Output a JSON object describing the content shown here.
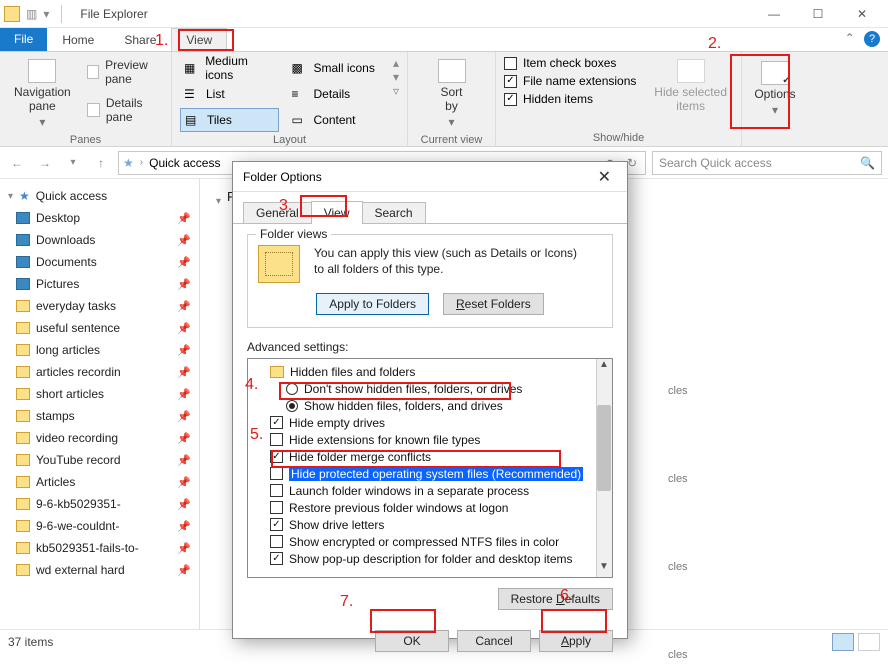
{
  "titlebar": {
    "title": "File Explorer"
  },
  "menu": {
    "file": "File",
    "home": "Home",
    "share": "Share",
    "view": "View"
  },
  "ribbon": {
    "panes": {
      "label": "Panes",
      "navigation": "Navigation\npane",
      "preview": "Preview pane",
      "details": "Details pane"
    },
    "layout": {
      "label": "Layout",
      "medium": "Medium icons",
      "small": "Small icons",
      "list": "List",
      "details": "Details",
      "tiles": "Tiles",
      "content": "Content"
    },
    "currentview": {
      "label": "Current view",
      "sortby": "Sort\nby"
    },
    "showhide": {
      "label": "Show/hide",
      "itemcheck": "Item check boxes",
      "fileext": "File name extensions",
      "hidden": "Hidden items",
      "hidesel": "Hide selected\nitems"
    },
    "options": "Options"
  },
  "nav": {
    "quickaccess": "Quick access",
    "searchPlaceholder": "Search Quick access"
  },
  "sidebar": {
    "root": "Quick access",
    "items": [
      "Desktop",
      "Downloads",
      "Documents",
      "Pictures",
      "everyday tasks",
      "useful sentence",
      "long articles",
      "articles recordin",
      "short articles",
      "stamps",
      "video recording",
      "YouTube record",
      "Articles",
      "9-6-kb5029351-",
      "9-6-we-couldnt-",
      "kb5029351-fails-to-",
      "wd external hard"
    ]
  },
  "content": {
    "heading": "Frequent folders",
    "tiles": [
      {
        "name": "",
        "sub": "cles"
      },
      {
        "name": "",
        "sub": "cles"
      },
      {
        "name": "",
        "sub": "cles"
      },
      {
        "name": "",
        "sub": "cles"
      }
    ]
  },
  "status": {
    "text": "37 items"
  },
  "dialog": {
    "title": "Folder Options",
    "tabs": {
      "general": "General",
      "view": "View",
      "search": "Search"
    },
    "folderviews": {
      "legend": "Folder views",
      "text": "You can apply this view (such as Details or Icons) to all folders of this type.",
      "apply": "Apply to Folders",
      "reset": "Reset Folders"
    },
    "advanced": {
      "label": "Advanced settings:",
      "rows": [
        {
          "kind": "folder",
          "indent": 1,
          "text": "Hidden files and folders"
        },
        {
          "kind": "radio",
          "indent": 2,
          "sel": false,
          "text": "Don't show hidden files, folders, or drives"
        },
        {
          "kind": "radio",
          "indent": 2,
          "sel": true,
          "text": "Show hidden files, folders, and drives"
        },
        {
          "kind": "check",
          "indent": 1,
          "sel": true,
          "text": "Hide empty drives"
        },
        {
          "kind": "check",
          "indent": 1,
          "sel": false,
          "text": "Hide extensions for known file types"
        },
        {
          "kind": "check",
          "indent": 1,
          "sel": true,
          "text": "Hide folder merge conflicts"
        },
        {
          "kind": "check",
          "indent": 1,
          "sel": false,
          "hl": true,
          "text": "Hide protected operating system files (Recommended)"
        },
        {
          "kind": "check",
          "indent": 1,
          "sel": false,
          "text": "Launch folder windows in a separate process"
        },
        {
          "kind": "check",
          "indent": 1,
          "sel": false,
          "text": "Restore previous folder windows at logon"
        },
        {
          "kind": "check",
          "indent": 1,
          "sel": true,
          "text": "Show drive letters"
        },
        {
          "kind": "check",
          "indent": 1,
          "sel": false,
          "text": "Show encrypted or compressed NTFS files in color"
        },
        {
          "kind": "check",
          "indent": 1,
          "sel": true,
          "text": "Show pop-up description for folder and desktop items"
        }
      ],
      "restore": "Restore Defaults"
    },
    "buttons": {
      "ok": "OK",
      "cancel": "Cancel",
      "apply": "Apply"
    }
  },
  "annotations": {
    "n1": "1.",
    "n2": "2.",
    "n3": "3.",
    "n4": "4.",
    "n5": "5.",
    "n6": "6.",
    "n7": "7."
  }
}
